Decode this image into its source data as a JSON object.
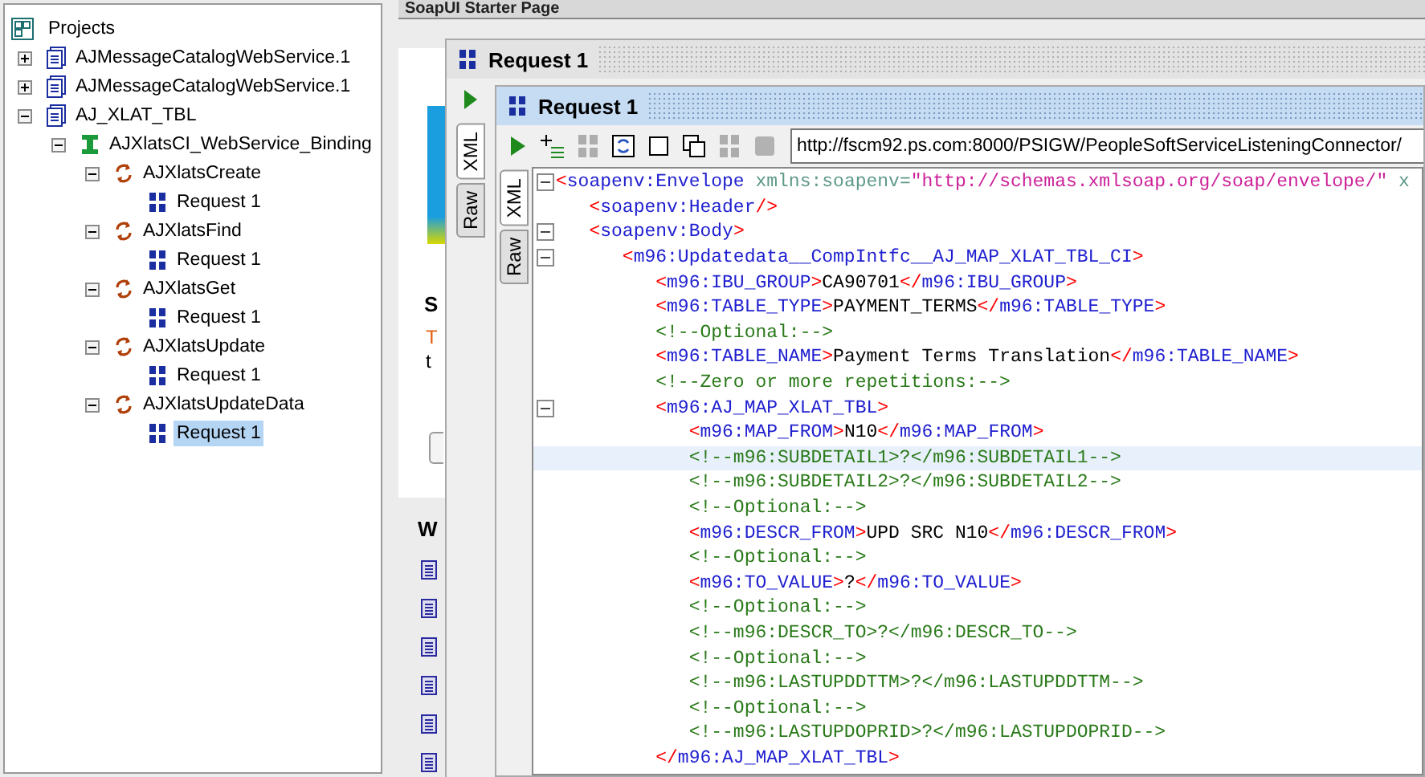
{
  "navigator": {
    "root": "Projects",
    "items": [
      {
        "kind": "project",
        "label": "AJMessageCatalogWebService.1",
        "expanded": false,
        "selected": false
      },
      {
        "kind": "project",
        "label": "AJMessageCatalogWebService.1",
        "expanded": false,
        "selected": false
      },
      {
        "kind": "project",
        "label": "AJ_XLAT_TBL",
        "expanded": true,
        "selected": false,
        "children": [
          {
            "kind": "interface",
            "label": "AJXlatsCI_WebService_Binding",
            "expanded": true,
            "selected": false,
            "children": [
              {
                "kind": "operation",
                "label": "AJXlatsCreate",
                "expanded": true,
                "selected": false,
                "children": [
                  {
                    "kind": "request",
                    "label": "Request 1",
                    "selected": false
                  }
                ]
              },
              {
                "kind": "operation",
                "label": "AJXlatsFind",
                "expanded": true,
                "selected": false,
                "children": [
                  {
                    "kind": "request",
                    "label": "Request 1",
                    "selected": false
                  }
                ]
              },
              {
                "kind": "operation",
                "label": "AJXlatsGet",
                "expanded": true,
                "selected": false,
                "children": [
                  {
                    "kind": "request",
                    "label": "Request 1",
                    "selected": false
                  }
                ]
              },
              {
                "kind": "operation",
                "label": "AJXlatsUpdate",
                "expanded": true,
                "selected": false,
                "children": [
                  {
                    "kind": "request",
                    "label": "Request 1",
                    "selected": false
                  }
                ]
              },
              {
                "kind": "operation",
                "label": "AJXlatsUpdateData",
                "expanded": true,
                "selected": false,
                "children": [
                  {
                    "kind": "request",
                    "label": "Request 1",
                    "selected": true
                  }
                ]
              }
            ]
          }
        ]
      }
    ]
  },
  "starter_tab": {
    "title": "SoapUI Starter Page"
  },
  "starter_page": {
    "heading": "S",
    "lines": [
      "T",
      "t"
    ],
    "subheading": "W"
  },
  "outer_window": {
    "title": "Request 1",
    "tabs": [
      {
        "label": "XML",
        "selected": true
      },
      {
        "label": "Raw",
        "selected": false
      }
    ]
  },
  "request_window": {
    "title": "Request 1",
    "toolbar": [
      {
        "kind": "run",
        "disabled": false
      },
      {
        "kind": "add",
        "disabled": false
      },
      {
        "kind": "soap",
        "disabled": true
      },
      {
        "kind": "format",
        "disabled": false
      },
      {
        "kind": "square",
        "disabled": false
      },
      {
        "kind": "copy",
        "disabled": false
      },
      {
        "kind": "soap",
        "disabled": true
      },
      {
        "kind": "stop",
        "disabled": true
      }
    ],
    "url": "http://fscm92.ps.com:8000/PSIGW/PeopleSoftServiceListeningConnector/",
    "tabs": [
      {
        "label": "XML",
        "selected": true
      },
      {
        "label": "Raw",
        "selected": false
      }
    ],
    "lines": [
      {
        "fold": true,
        "current": false,
        "tokens": [
          {
            "kind": "punct",
            "text": "<"
          },
          {
            "kind": "name",
            "text": "soapenv:Envelope"
          },
          {
            "kind": "attr",
            "text": " xmlns:soapenv="
          },
          {
            "kind": "value",
            "text": "\"http://schemas.xmlsoap.org/soap/envelope/\""
          },
          {
            "kind": "attr",
            "text": " x"
          }
        ]
      },
      {
        "fold": false,
        "current": false,
        "tokens": [
          {
            "kind": "punct",
            "text": "   <"
          },
          {
            "kind": "name",
            "text": "soapenv:Header"
          },
          {
            "kind": "punct",
            "text": "/>"
          }
        ]
      },
      {
        "fold": true,
        "current": false,
        "tokens": [
          {
            "kind": "punct",
            "text": "   <"
          },
          {
            "kind": "name",
            "text": "soapenv:Body"
          },
          {
            "kind": "punct",
            "text": ">"
          }
        ]
      },
      {
        "fold": true,
        "current": false,
        "tokens": [
          {
            "kind": "punct",
            "text": "      <"
          },
          {
            "kind": "name",
            "text": "m96:Updatedata__CompIntfc__AJ_MAP_XLAT_TBL_CI"
          },
          {
            "kind": "punct",
            "text": ">"
          }
        ]
      },
      {
        "fold": false,
        "current": false,
        "tokens": [
          {
            "kind": "punct",
            "text": "         <"
          },
          {
            "kind": "name",
            "text": "m96:IBU_GROUP"
          },
          {
            "kind": "punct",
            "text": ">"
          },
          {
            "kind": "text",
            "text": "CA90701"
          },
          {
            "kind": "punct",
            "text": "</"
          },
          {
            "kind": "name",
            "text": "m96:IBU_GROUP"
          },
          {
            "kind": "punct",
            "text": ">"
          }
        ]
      },
      {
        "fold": false,
        "current": false,
        "tokens": [
          {
            "kind": "punct",
            "text": "         <"
          },
          {
            "kind": "name",
            "text": "m96:TABLE_TYPE"
          },
          {
            "kind": "punct",
            "text": ">"
          },
          {
            "kind": "text",
            "text": "PAYMENT_TERMS"
          },
          {
            "kind": "punct",
            "text": "</"
          },
          {
            "kind": "name",
            "text": "m96:TABLE_TYPE"
          },
          {
            "kind": "punct",
            "text": ">"
          }
        ]
      },
      {
        "fold": false,
        "current": false,
        "tokens": [
          {
            "kind": "comment",
            "text": "         <!--Optional:-->"
          }
        ]
      },
      {
        "fold": false,
        "current": false,
        "tokens": [
          {
            "kind": "punct",
            "text": "         <"
          },
          {
            "kind": "name",
            "text": "m96:TABLE_NAME"
          },
          {
            "kind": "punct",
            "text": ">"
          },
          {
            "kind": "text",
            "text": "Payment Terms Translation"
          },
          {
            "kind": "punct",
            "text": "</"
          },
          {
            "kind": "name",
            "text": "m96:TABLE_NAME"
          },
          {
            "kind": "punct",
            "text": ">"
          }
        ]
      },
      {
        "fold": false,
        "current": false,
        "tokens": [
          {
            "kind": "comment",
            "text": "         <!--Zero or more repetitions:-->"
          }
        ]
      },
      {
        "fold": true,
        "current": false,
        "tokens": [
          {
            "kind": "punct",
            "text": "         <"
          },
          {
            "kind": "name",
            "text": "m96:AJ_MAP_XLAT_TBL"
          },
          {
            "kind": "punct",
            "text": ">"
          }
        ]
      },
      {
        "fold": false,
        "current": false,
        "tokens": [
          {
            "kind": "punct",
            "text": "            <"
          },
          {
            "kind": "name",
            "text": "m96:MAP_FROM"
          },
          {
            "kind": "punct",
            "text": ">"
          },
          {
            "kind": "text",
            "text": "N10"
          },
          {
            "kind": "punct",
            "text": "</"
          },
          {
            "kind": "name",
            "text": "m96:MAP_FROM"
          },
          {
            "kind": "punct",
            "text": ">"
          }
        ]
      },
      {
        "fold": false,
        "current": true,
        "tokens": [
          {
            "kind": "comment",
            "text": "            <!--m96:SUBDETAIL1>?</m96:SUBDETAIL1-->"
          }
        ]
      },
      {
        "fold": false,
        "current": false,
        "tokens": [
          {
            "kind": "comment",
            "text": "            <!--m96:SUBDETAIL2>?</m96:SUBDETAIL2-->"
          }
        ]
      },
      {
        "fold": false,
        "current": false,
        "tokens": [
          {
            "kind": "comment",
            "text": "            <!--Optional:-->"
          }
        ]
      },
      {
        "fold": false,
        "current": false,
        "tokens": [
          {
            "kind": "punct",
            "text": "            <"
          },
          {
            "kind": "name",
            "text": "m96:DESCR_FROM"
          },
          {
            "kind": "punct",
            "text": ">"
          },
          {
            "kind": "text",
            "text": "UPD SRC N10"
          },
          {
            "kind": "punct",
            "text": "</"
          },
          {
            "kind": "name",
            "text": "m96:DESCR_FROM"
          },
          {
            "kind": "punct",
            "text": ">"
          }
        ]
      },
      {
        "fold": false,
        "current": false,
        "tokens": [
          {
            "kind": "comment",
            "text": "            <!--Optional:-->"
          }
        ]
      },
      {
        "fold": false,
        "current": false,
        "tokens": [
          {
            "kind": "punct",
            "text": "            <"
          },
          {
            "kind": "name",
            "text": "m96:TO_VALUE"
          },
          {
            "kind": "punct",
            "text": ">"
          },
          {
            "kind": "text",
            "text": "?"
          },
          {
            "kind": "punct",
            "text": "</"
          },
          {
            "kind": "name",
            "text": "m96:TO_VALUE"
          },
          {
            "kind": "punct",
            "text": ">"
          }
        ]
      },
      {
        "fold": false,
        "current": false,
        "tokens": [
          {
            "kind": "comment",
            "text": "            <!--Optional:-->"
          }
        ]
      },
      {
        "fold": false,
        "current": false,
        "tokens": [
          {
            "kind": "comment",
            "text": "            <!--m96:DESCR_TO>?</m96:DESCR_TO-->"
          }
        ]
      },
      {
        "fold": false,
        "current": false,
        "tokens": [
          {
            "kind": "comment",
            "text": "            <!--Optional:-->"
          }
        ]
      },
      {
        "fold": false,
        "current": false,
        "tokens": [
          {
            "kind": "comment",
            "text": "            <!--m96:LASTUPDDTTM>?</m96:LASTUPDDTTM-->"
          }
        ]
      },
      {
        "fold": false,
        "current": false,
        "tokens": [
          {
            "kind": "comment",
            "text": "            <!--Optional:-->"
          }
        ]
      },
      {
        "fold": false,
        "current": false,
        "tokens": [
          {
            "kind": "comment",
            "text": "            <!--m96:LASTUPDOPRID>?</m96:LASTUPDOPRID-->"
          }
        ]
      },
      {
        "fold": false,
        "current": false,
        "tokens": [
          {
            "kind": "punct",
            "text": "         </"
          },
          {
            "kind": "name",
            "text": "m96:AJ_MAP_XLAT_TBL"
          },
          {
            "kind": "punct",
            "text": ">"
          }
        ]
      }
    ]
  }
}
